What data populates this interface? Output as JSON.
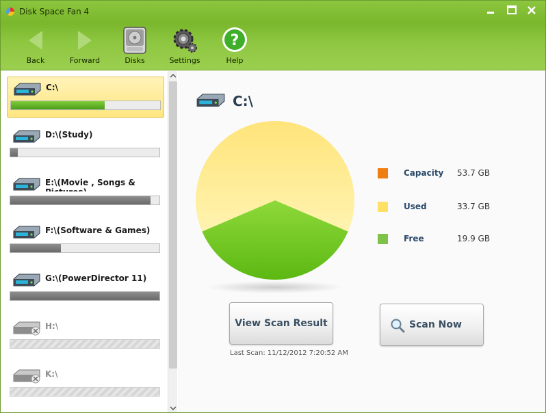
{
  "window": {
    "title": "Disk Space Fan 4",
    "buttons": [
      "minimize",
      "maximize",
      "close"
    ]
  },
  "toolbar": {
    "items": [
      {
        "label": "Back",
        "icon": "back-arrow-icon",
        "enabled": false
      },
      {
        "label": "Forward",
        "icon": "forward-arrow-icon",
        "enabled": false
      },
      {
        "label": "Disks",
        "icon": "hard-disk-icon",
        "enabled": true
      },
      {
        "label": "Settings",
        "icon": "gear-icon",
        "enabled": true
      },
      {
        "label": "Help",
        "icon": "help-icon",
        "enabled": true
      }
    ]
  },
  "drives": [
    {
      "label": "C:\\",
      "used_fraction": 0.63,
      "fill": "green",
      "selected": true,
      "available": true
    },
    {
      "label": "D:\\(Study)",
      "used_fraction": 0.05,
      "fill": "gray",
      "selected": false,
      "available": true
    },
    {
      "label": "E:\\(Movie , Songs & Pictures)",
      "used_fraction": 0.94,
      "fill": "gray",
      "selected": false,
      "available": true
    },
    {
      "label": "F:\\(Software & Games)",
      "used_fraction": 0.34,
      "fill": "gray",
      "selected": false,
      "available": true
    },
    {
      "label": "G:\\(PowerDirector 11)",
      "used_fraction": 1.0,
      "fill": "gray",
      "selected": false,
      "available": true
    },
    {
      "label": "H:\\",
      "used_fraction": 0,
      "fill": "none",
      "selected": false,
      "available": false
    },
    {
      "label": "K:\\",
      "used_fraction": 0,
      "fill": "none",
      "selected": false,
      "available": false
    }
  ],
  "details": {
    "drive_title": "C:\\",
    "legend": [
      {
        "name": "Capacity",
        "value": "53.7 GB",
        "color": "#f07d12"
      },
      {
        "name": "Used",
        "value": "33.7 GB",
        "color": "#ffe066"
      },
      {
        "name": "Free",
        "value": "19.9 GB",
        "color": "#7fc24a"
      }
    ],
    "pie": {
      "used_gb": 33.7,
      "free_gb": 19.9,
      "used_color": "#ffe47a",
      "free_color": "#6cc21c"
    },
    "view_scan_label": "View Scan Result",
    "scan_now_label": "Scan Now",
    "last_scan": "Last Scan: 11/12/2012 7:20:52 AM"
  }
}
